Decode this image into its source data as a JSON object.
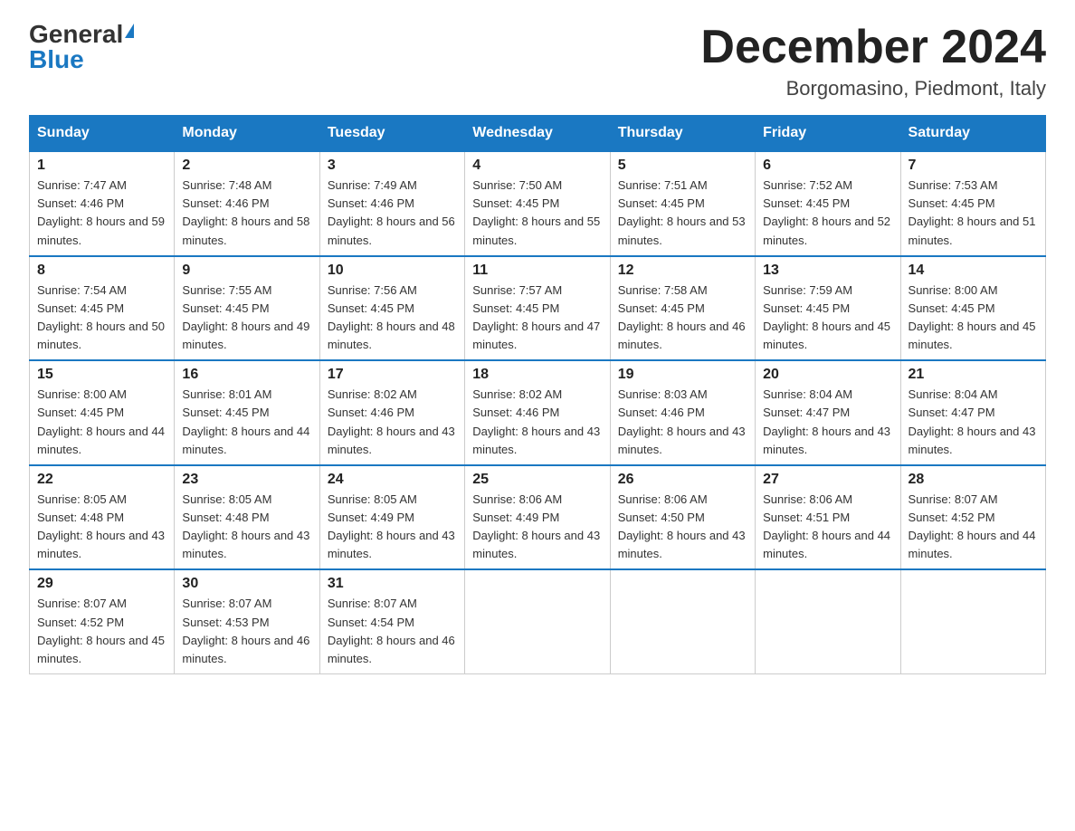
{
  "header": {
    "logo_general": "General",
    "logo_blue": "Blue",
    "title": "December 2024",
    "subtitle": "Borgomasino, Piedmont, Italy"
  },
  "columns": [
    "Sunday",
    "Monday",
    "Tuesday",
    "Wednesday",
    "Thursday",
    "Friday",
    "Saturday"
  ],
  "weeks": [
    [
      {
        "day": "1",
        "sunrise": "7:47 AM",
        "sunset": "4:46 PM",
        "daylight": "8 hours and 59 minutes."
      },
      {
        "day": "2",
        "sunrise": "7:48 AM",
        "sunset": "4:46 PM",
        "daylight": "8 hours and 58 minutes."
      },
      {
        "day": "3",
        "sunrise": "7:49 AM",
        "sunset": "4:46 PM",
        "daylight": "8 hours and 56 minutes."
      },
      {
        "day": "4",
        "sunrise": "7:50 AM",
        "sunset": "4:45 PM",
        "daylight": "8 hours and 55 minutes."
      },
      {
        "day": "5",
        "sunrise": "7:51 AM",
        "sunset": "4:45 PM",
        "daylight": "8 hours and 53 minutes."
      },
      {
        "day": "6",
        "sunrise": "7:52 AM",
        "sunset": "4:45 PM",
        "daylight": "8 hours and 52 minutes."
      },
      {
        "day": "7",
        "sunrise": "7:53 AM",
        "sunset": "4:45 PM",
        "daylight": "8 hours and 51 minutes."
      }
    ],
    [
      {
        "day": "8",
        "sunrise": "7:54 AM",
        "sunset": "4:45 PM",
        "daylight": "8 hours and 50 minutes."
      },
      {
        "day": "9",
        "sunrise": "7:55 AM",
        "sunset": "4:45 PM",
        "daylight": "8 hours and 49 minutes."
      },
      {
        "day": "10",
        "sunrise": "7:56 AM",
        "sunset": "4:45 PM",
        "daylight": "8 hours and 48 minutes."
      },
      {
        "day": "11",
        "sunrise": "7:57 AM",
        "sunset": "4:45 PM",
        "daylight": "8 hours and 47 minutes."
      },
      {
        "day": "12",
        "sunrise": "7:58 AM",
        "sunset": "4:45 PM",
        "daylight": "8 hours and 46 minutes."
      },
      {
        "day": "13",
        "sunrise": "7:59 AM",
        "sunset": "4:45 PM",
        "daylight": "8 hours and 45 minutes."
      },
      {
        "day": "14",
        "sunrise": "8:00 AM",
        "sunset": "4:45 PM",
        "daylight": "8 hours and 45 minutes."
      }
    ],
    [
      {
        "day": "15",
        "sunrise": "8:00 AM",
        "sunset": "4:45 PM",
        "daylight": "8 hours and 44 minutes."
      },
      {
        "day": "16",
        "sunrise": "8:01 AM",
        "sunset": "4:45 PM",
        "daylight": "8 hours and 44 minutes."
      },
      {
        "day": "17",
        "sunrise": "8:02 AM",
        "sunset": "4:46 PM",
        "daylight": "8 hours and 43 minutes."
      },
      {
        "day": "18",
        "sunrise": "8:02 AM",
        "sunset": "4:46 PM",
        "daylight": "8 hours and 43 minutes."
      },
      {
        "day": "19",
        "sunrise": "8:03 AM",
        "sunset": "4:46 PM",
        "daylight": "8 hours and 43 minutes."
      },
      {
        "day": "20",
        "sunrise": "8:04 AM",
        "sunset": "4:47 PM",
        "daylight": "8 hours and 43 minutes."
      },
      {
        "day": "21",
        "sunrise": "8:04 AM",
        "sunset": "4:47 PM",
        "daylight": "8 hours and 43 minutes."
      }
    ],
    [
      {
        "day": "22",
        "sunrise": "8:05 AM",
        "sunset": "4:48 PM",
        "daylight": "8 hours and 43 minutes."
      },
      {
        "day": "23",
        "sunrise": "8:05 AM",
        "sunset": "4:48 PM",
        "daylight": "8 hours and 43 minutes."
      },
      {
        "day": "24",
        "sunrise": "8:05 AM",
        "sunset": "4:49 PM",
        "daylight": "8 hours and 43 minutes."
      },
      {
        "day": "25",
        "sunrise": "8:06 AM",
        "sunset": "4:49 PM",
        "daylight": "8 hours and 43 minutes."
      },
      {
        "day": "26",
        "sunrise": "8:06 AM",
        "sunset": "4:50 PM",
        "daylight": "8 hours and 43 minutes."
      },
      {
        "day": "27",
        "sunrise": "8:06 AM",
        "sunset": "4:51 PM",
        "daylight": "8 hours and 44 minutes."
      },
      {
        "day": "28",
        "sunrise": "8:07 AM",
        "sunset": "4:52 PM",
        "daylight": "8 hours and 44 minutes."
      }
    ],
    [
      {
        "day": "29",
        "sunrise": "8:07 AM",
        "sunset": "4:52 PM",
        "daylight": "8 hours and 45 minutes."
      },
      {
        "day": "30",
        "sunrise": "8:07 AM",
        "sunset": "4:53 PM",
        "daylight": "8 hours and 46 minutes."
      },
      {
        "day": "31",
        "sunrise": "8:07 AM",
        "sunset": "4:54 PM",
        "daylight": "8 hours and 46 minutes."
      },
      null,
      null,
      null,
      null
    ]
  ]
}
